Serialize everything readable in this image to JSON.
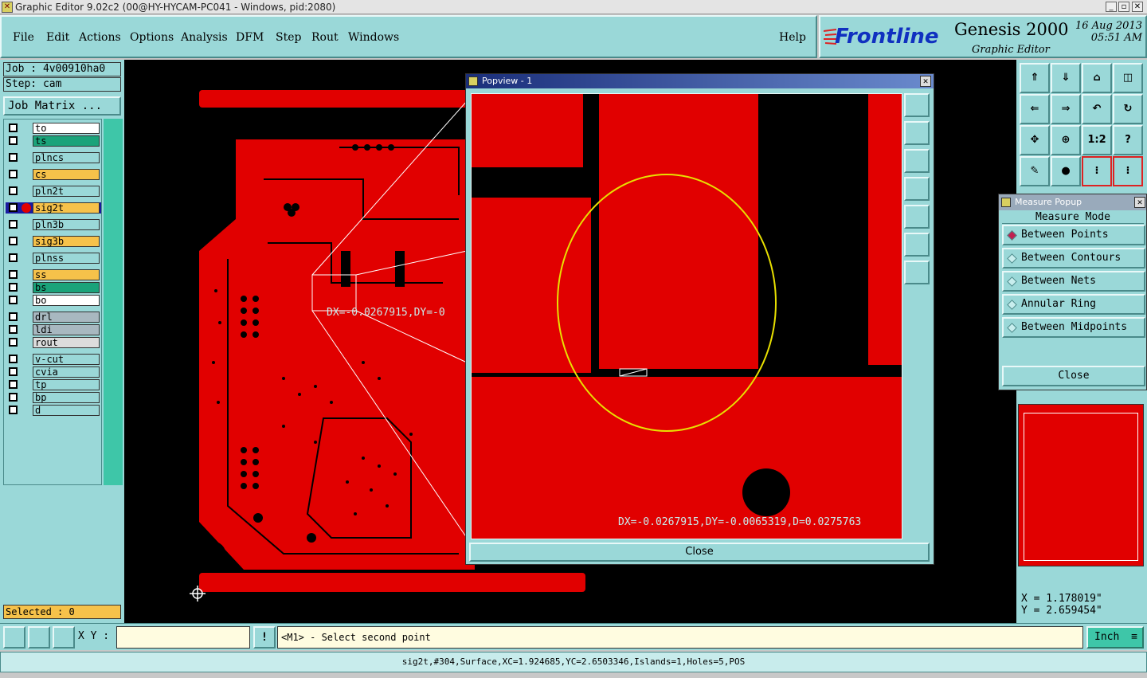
{
  "window": {
    "title": "Graphic Editor 9.02c2 (00@HY-HYCAM-PC041 - Windows, pid:2080)"
  },
  "menu": {
    "items": [
      "File",
      "Edit",
      "Actions",
      "Options",
      "Analysis",
      "DFM",
      "Step",
      "Rout",
      "Windows"
    ],
    "help": "Help"
  },
  "logo": {
    "brand": "Frontline",
    "product": "Genesis 2000",
    "subtitle": "Graphic Editor",
    "date": "16 Aug 2013",
    "time": "05:51 AM"
  },
  "job": {
    "job_label": "Job : 4v00910ha0",
    "step_label": "Step: cam",
    "job_matrix": "Job Matrix ..."
  },
  "layers": [
    {
      "name": "to",
      "color": "#ffffff"
    },
    {
      "name": "ts",
      "color": "#1aa37a"
    },
    {
      "name": "plncs",
      "color": "#9ad8d8"
    },
    {
      "name": "cs",
      "color": "#f6c24a"
    },
    {
      "name": "pln2t",
      "color": "#9ad8d8"
    },
    {
      "name": "sig2t",
      "color": "#f6c24a"
    },
    {
      "name": "pln3b",
      "color": "#9ad8d8"
    },
    {
      "name": "sig3b",
      "color": "#f6c24a"
    },
    {
      "name": "plnss",
      "color": "#9ad8d8"
    },
    {
      "name": "ss",
      "color": "#f6c24a"
    },
    {
      "name": "bs",
      "color": "#1aa37a"
    },
    {
      "name": "bo",
      "color": "#ffffff"
    },
    {
      "name": "drl",
      "color": "#a8b8c0"
    },
    {
      "name": "ldi",
      "color": "#a8b8c0"
    },
    {
      "name": "rout",
      "color": "#dcdcdc"
    },
    {
      "name": "v-cut",
      "color": "#9ad8d8"
    },
    {
      "name": "cvia",
      "color": "#9ad8d8"
    },
    {
      "name": "tp",
      "color": "#9ad8d8"
    },
    {
      "name": "bp",
      "color": "#9ad8d8"
    },
    {
      "name": "d",
      "color": "#9ad8d8"
    }
  ],
  "selected": "Selected : 0",
  "canvas": {
    "measure_text": "DX=-0.0267915,DY=-0"
  },
  "popview": {
    "title": "Popview - 1",
    "measure_text": "DX=-0.0267915,DY=-0.0065319,D=0.0275763",
    "close": "Close"
  },
  "toolbar": {
    "zoom_ratio": "1:2",
    "help_q": "?"
  },
  "measure": {
    "title": "Measure Popup",
    "header": "Measure Mode",
    "options": [
      "Between Points",
      "Between Contours",
      "Between Nets",
      "Annular Ring",
      "Between Midpoints"
    ],
    "close": "Close"
  },
  "coords": {
    "x": "X = 1.178019\"",
    "y": "Y = 2.659454\""
  },
  "bottom": {
    "xy_label": "X Y :",
    "xy_value": "",
    "prompt": "<M1> - Select second point",
    "units": "Inch",
    "warn": "!"
  },
  "status": "sig2t,#304,Surface,XC=1.924685,YC=2.6503346,Islands=1,Holes=5,POS",
  "colors": {
    "board_red": "#e10000",
    "panel_cyan": "#9ad8d8",
    "ellipse_yellow": "#e8e000"
  }
}
